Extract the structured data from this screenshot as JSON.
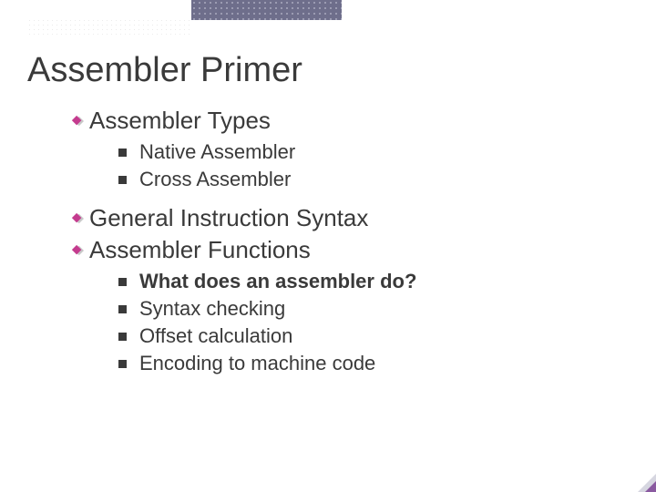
{
  "title": "Assembler Primer",
  "sections": [
    {
      "label": "Assembler Types",
      "items": [
        {
          "text": "Native Assembler",
          "bold": false
        },
        {
          "text": "Cross Assembler",
          "bold": false
        }
      ]
    },
    {
      "label": "General Instruction Syntax",
      "items": []
    },
    {
      "label": "Assembler Functions",
      "items": [
        {
          "text": "What does an assembler do?",
          "bold": true
        },
        {
          "text": "Syntax checking",
          "bold": false
        },
        {
          "text": "Offset calculation",
          "bold": false
        },
        {
          "text": "Encoding to machine code",
          "bold": false
        }
      ]
    }
  ],
  "colors": {
    "diamond_fill": "#c43b8e",
    "diamond_shadow": "#c8c8c8",
    "accent_block": "#555577"
  }
}
